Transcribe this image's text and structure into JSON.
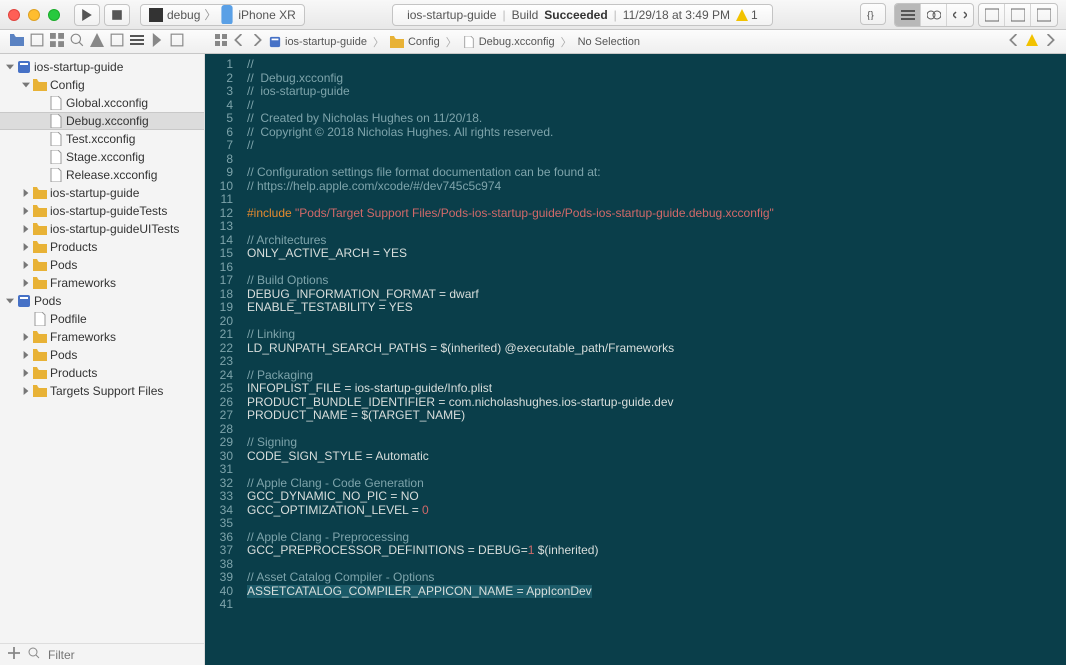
{
  "titlebar": {
    "scheme": {
      "target": "debug",
      "device": "iPhone XR"
    },
    "status": {
      "project": "ios-startup-guide",
      "action": "Build",
      "result": "Succeeded",
      "time": "11/29/18 at 3:49 PM",
      "warnings": "1"
    }
  },
  "navigator_icons": [
    "project",
    "sourcecontrol",
    "symbols",
    "find",
    "issues",
    "tests",
    "debug",
    "breakpoints",
    "reports"
  ],
  "breadcrumb": {
    "project": "ios-startup-guide",
    "folder": "Config",
    "file": "Debug.xcconfig",
    "selection": "No Selection"
  },
  "tree": [
    {
      "d": 0,
      "t": "proj",
      "open": true,
      "name": "ios-startup-guide"
    },
    {
      "d": 1,
      "t": "folder",
      "open": true,
      "name": "Config"
    },
    {
      "d": 2,
      "t": "file",
      "name": "Global.xcconfig"
    },
    {
      "d": 2,
      "t": "file",
      "name": "Debug.xcconfig",
      "selected": true
    },
    {
      "d": 2,
      "t": "file",
      "name": "Test.xcconfig"
    },
    {
      "d": 2,
      "t": "file",
      "name": "Stage.xcconfig"
    },
    {
      "d": 2,
      "t": "file",
      "name": "Release.xcconfig"
    },
    {
      "d": 1,
      "t": "folder",
      "closed": true,
      "name": "ios-startup-guide"
    },
    {
      "d": 1,
      "t": "folder",
      "closed": true,
      "name": "ios-startup-guideTests"
    },
    {
      "d": 1,
      "t": "folder",
      "closed": true,
      "name": "ios-startup-guideUITests"
    },
    {
      "d": 1,
      "t": "folder",
      "closed": true,
      "name": "Products"
    },
    {
      "d": 1,
      "t": "folder",
      "closed": true,
      "name": "Pods"
    },
    {
      "d": 1,
      "t": "folder",
      "closed": true,
      "name": "Frameworks"
    },
    {
      "d": 0,
      "t": "proj",
      "open": true,
      "name": "Pods"
    },
    {
      "d": 1,
      "t": "rfile",
      "name": "Podfile"
    },
    {
      "d": 1,
      "t": "folder",
      "closed": true,
      "name": "Frameworks"
    },
    {
      "d": 1,
      "t": "folder",
      "closed": true,
      "name": "Pods"
    },
    {
      "d": 1,
      "t": "folder",
      "closed": true,
      "name": "Products"
    },
    {
      "d": 1,
      "t": "folder",
      "closed": true,
      "name": "Targets Support Files"
    }
  ],
  "filter_placeholder": "Filter",
  "code_lines": [
    {
      "n": 1,
      "c": "cm",
      "t": "//"
    },
    {
      "n": 2,
      "c": "cm",
      "t": "//  Debug.xcconfig"
    },
    {
      "n": 3,
      "c": "cm",
      "t": "//  ios-startup-guide"
    },
    {
      "n": 4,
      "c": "cm",
      "t": "//"
    },
    {
      "n": 5,
      "c": "cm",
      "t": "//  Created by Nicholas Hughes on 11/20/18."
    },
    {
      "n": 6,
      "c": "cm",
      "t": "//  Copyright © 2018 Nicholas Hughes. All rights reserved."
    },
    {
      "n": 7,
      "c": "cm",
      "t": "//"
    },
    {
      "n": 8,
      "c": "",
      "t": ""
    },
    {
      "n": 9,
      "c": "cm",
      "t": "// Configuration settings file format documentation can be found at:"
    },
    {
      "n": 10,
      "c": "cm",
      "t": "// https://help.apple.com/xcode/#/dev745c5c974"
    },
    {
      "n": 11,
      "c": "",
      "t": ""
    },
    {
      "n": 12,
      "c": "",
      "html": "<span class='inc'>#include </span><span class='str'>\"Pods/Target Support Files/Pods-ios-startup-guide/Pods-ios-startup-guide.debug.xcconfig\"</span>"
    },
    {
      "n": 13,
      "c": "",
      "t": ""
    },
    {
      "n": 14,
      "c": "cm",
      "t": "// Architectures"
    },
    {
      "n": 15,
      "c": "",
      "t": "ONLY_ACTIVE_ARCH = YES"
    },
    {
      "n": 16,
      "c": "",
      "t": ""
    },
    {
      "n": 17,
      "c": "cm",
      "t": "// Build Options"
    },
    {
      "n": 18,
      "c": "",
      "t": "DEBUG_INFORMATION_FORMAT = dwarf"
    },
    {
      "n": 19,
      "c": "",
      "t": "ENABLE_TESTABILITY = YES"
    },
    {
      "n": 20,
      "c": "",
      "t": ""
    },
    {
      "n": 21,
      "c": "cm",
      "t": "// Linking"
    },
    {
      "n": 22,
      "c": "",
      "t": "LD_RUNPATH_SEARCH_PATHS = $(inherited) @executable_path/Frameworks"
    },
    {
      "n": 23,
      "c": "",
      "t": ""
    },
    {
      "n": 24,
      "c": "cm",
      "t": "// Packaging"
    },
    {
      "n": 25,
      "c": "",
      "t": "INFOPLIST_FILE = ios-startup-guide/Info.plist"
    },
    {
      "n": 26,
      "c": "",
      "t": "PRODUCT_BUNDLE_IDENTIFIER = com.nicholashughes.ios-startup-guide.dev"
    },
    {
      "n": 27,
      "c": "",
      "t": "PRODUCT_NAME = $(TARGET_NAME)"
    },
    {
      "n": 28,
      "c": "",
      "t": ""
    },
    {
      "n": 29,
      "c": "cm",
      "t": "// Signing"
    },
    {
      "n": 30,
      "c": "",
      "t": "CODE_SIGN_STYLE = Automatic"
    },
    {
      "n": 31,
      "c": "",
      "t": ""
    },
    {
      "n": 32,
      "c": "cm",
      "t": "// Apple Clang - Code Generation"
    },
    {
      "n": 33,
      "c": "",
      "t": "GCC_DYNAMIC_NO_PIC = NO"
    },
    {
      "n": 34,
      "c": "",
      "html": "GCC_OPTIMIZATION_LEVEL = <span class='num'>0</span>"
    },
    {
      "n": 35,
      "c": "",
      "t": ""
    },
    {
      "n": 36,
      "c": "cm",
      "t": "// Apple Clang - Preprocessing"
    },
    {
      "n": 37,
      "c": "",
      "html": "GCC_PREPROCESSOR_DEFINITIONS = DEBUG=<span class='num'>1</span> $(inherited)"
    },
    {
      "n": 38,
      "c": "",
      "t": ""
    },
    {
      "n": 39,
      "c": "cm",
      "t": "// Asset Catalog Compiler - Options"
    },
    {
      "n": 40,
      "c": "",
      "html": "<span class='sel-line'>ASSETCATALOG_COMPILER_APPICON_NAME = AppIconDev</span>"
    },
    {
      "n": 41,
      "c": "",
      "t": ""
    }
  ]
}
